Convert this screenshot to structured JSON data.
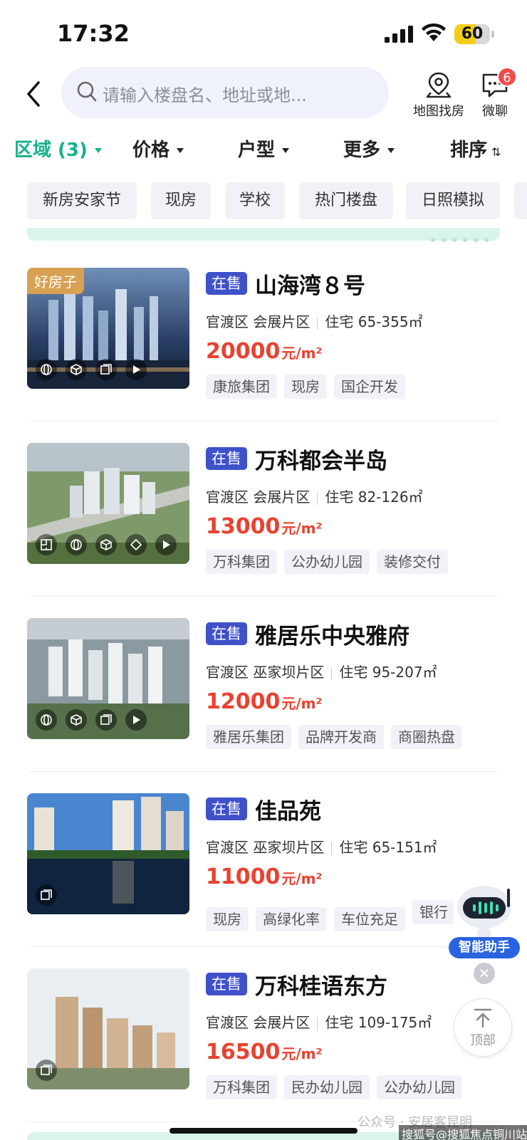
{
  "status_bar": {
    "time": "17:32",
    "battery": "60"
  },
  "search": {
    "placeholder": "请输入楼盘名、地址或地..."
  },
  "header_actions": {
    "map_label": "地图找房",
    "chat_label": "微聊",
    "chat_badge": "6"
  },
  "filters": [
    {
      "label": "区域 (3)",
      "active": true
    },
    {
      "label": "价格"
    },
    {
      "label": "户型"
    },
    {
      "label": "更多"
    },
    {
      "label": "排序"
    }
  ],
  "quick_tags": [
    "新房安家节",
    "现房",
    "学校",
    "热门楼盘",
    "日照模拟"
  ],
  "listings": [
    {
      "badge": "好房子",
      "status": "在售",
      "name": "山海湾８号",
      "district": "官渡区",
      "area": "会展片区",
      "type_size": "住宅 65-355㎡",
      "price": "20000",
      "unit": "元/m²",
      "tags": [
        "康旅集团",
        "现房",
        "国企开发"
      ]
    },
    {
      "status": "在售",
      "name": "万科都会半岛",
      "district": "官渡区",
      "area": "会展片区",
      "type_size": "住宅 82-126㎡",
      "price": "13000",
      "unit": "元/m²",
      "tags": [
        "万科集团",
        "公办幼儿园",
        "装修交付"
      ]
    },
    {
      "status": "在售",
      "name": "雅居乐中央雅府",
      "district": "官渡区",
      "area": "巫家坝片区",
      "type_size": "住宅 95-207㎡",
      "price": "12000",
      "unit": "元/m²",
      "tags": [
        "雅居乐集团",
        "品牌开发商",
        "商圈热盘"
      ]
    },
    {
      "status": "在售",
      "name": "佳品苑",
      "district": "官渡区",
      "area": "巫家坝片区",
      "type_size": "住宅 65-151㎡",
      "price": "11000",
      "unit": "元/m²",
      "tags": [
        "现房",
        "高绿化率",
        "车位充足",
        "银行"
      ]
    },
    {
      "status": "在售",
      "name": "万科桂语东方",
      "district": "官渡区",
      "area": "会展片区",
      "type_size": "住宅 109-175㎡",
      "price": "16500",
      "unit": "元/m²",
      "tags": [
        "万科集团",
        "民办幼儿园",
        "公办幼儿园"
      ]
    }
  ],
  "assistant": {
    "label": "智能助手"
  },
  "back_to_top": {
    "label": "顶部"
  },
  "watermark": {
    "line1": "公众号 · 安居客昆明",
    "line2": "搜狐号@搜狐焦点铜川站"
  },
  "colors": {
    "accent": "#16b28a",
    "price": "#e8422f",
    "status_tag": "#3f51c9",
    "badge": "#d8a153"
  }
}
